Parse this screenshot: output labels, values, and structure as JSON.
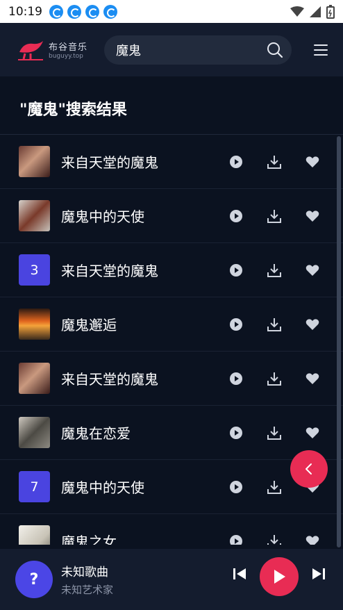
{
  "status_bar": {
    "time": "10:19"
  },
  "header": {
    "logo_name": "布谷音乐",
    "logo_sub": "buguyy.top",
    "search_value": "魔鬼"
  },
  "results_title": "\"魔鬼\"搜索结果",
  "songs": [
    {
      "title": "来自天堂的魔鬼",
      "cover": "photo"
    },
    {
      "title": "魔鬼中的天使",
      "cover": "photo"
    },
    {
      "title": "来自天堂的魔鬼",
      "cover": "number",
      "number": "3"
    },
    {
      "title": "魔鬼邂逅",
      "cover": "photo"
    },
    {
      "title": "来自天堂的魔鬼",
      "cover": "photo"
    },
    {
      "title": "魔鬼在恋爱",
      "cover": "photo"
    },
    {
      "title": "魔鬼中的天使",
      "cover": "number",
      "number": "7"
    },
    {
      "title": "魔鬼之女",
      "cover": "photo"
    }
  ],
  "player": {
    "avatar_text": "?",
    "song_title": "未知歌曲",
    "artist": "未知艺术家"
  },
  "colors": {
    "background": "#0b1220",
    "accent": "#e82c54",
    "number_badge": "#4a44e0"
  },
  "icons": [
    "play-icon",
    "download-icon",
    "heart-icon",
    "search-icon",
    "menu-icon",
    "back-icon",
    "skip-previous-icon",
    "skip-next-icon"
  ]
}
